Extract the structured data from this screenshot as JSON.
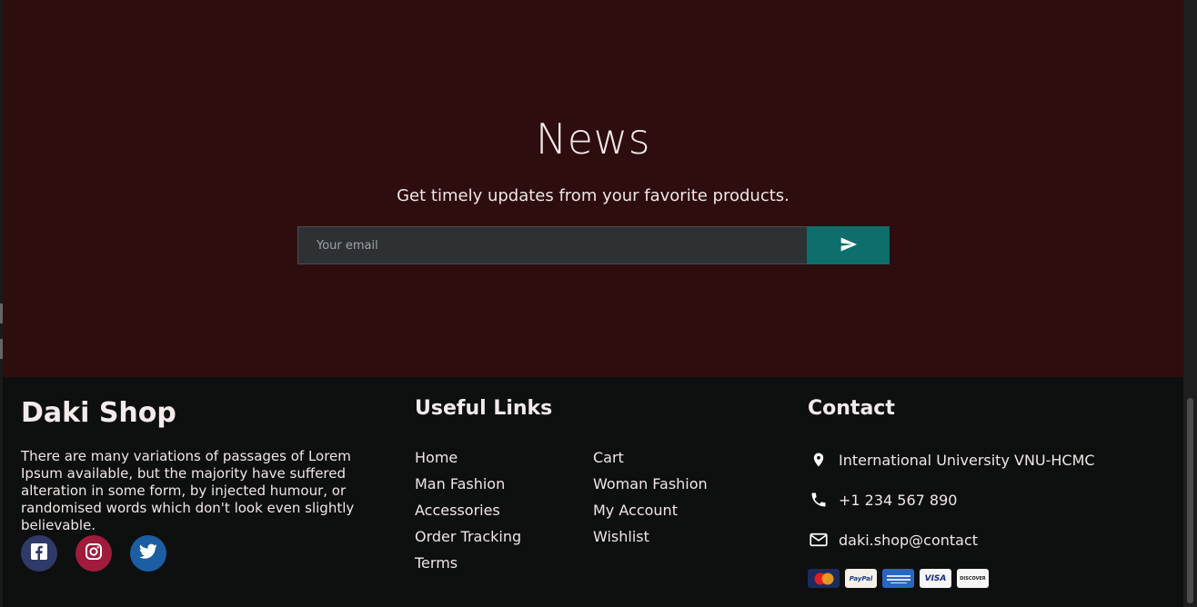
{
  "news": {
    "title": "News",
    "subtitle": "Get timely updates from your favorite products.",
    "email_placeholder": "Your email",
    "send_icon": "send-icon"
  },
  "footer": {
    "brand": "Daki Shop",
    "about": "There are many variations of passages of Lorem Ipsum available, but the majority have suffered alteration in some form, by injected humour, or randomised words which don't look even slightly believable.",
    "social": [
      {
        "icon": "facebook-icon",
        "color": "#2f3a68"
      },
      {
        "icon": "instagram-icon",
        "color": "#a01b3c"
      },
      {
        "icon": "twitter-icon",
        "color": "#1c5ea3"
      }
    ],
    "useful_links": {
      "heading": "Useful Links",
      "col1": [
        "Home",
        "Man Fashion",
        "Accessories",
        "Order Tracking",
        "Terms"
      ],
      "col2": [
        "Cart",
        "Woman Fashion",
        "My Account",
        "Wishlist"
      ]
    },
    "contact": {
      "heading": "Contact",
      "address": "International University VNU-HCMC",
      "phone": "+1 234 567 890",
      "email": "daki.shop@contact",
      "payments": [
        "MasterCard",
        "PayPal",
        "American Express",
        "VISA",
        "DISCOVER"
      ]
    }
  },
  "colors": {
    "news_bg": "#2e0d0f",
    "footer_bg": "#0e0f0f",
    "accent": "#0e6e6b"
  }
}
